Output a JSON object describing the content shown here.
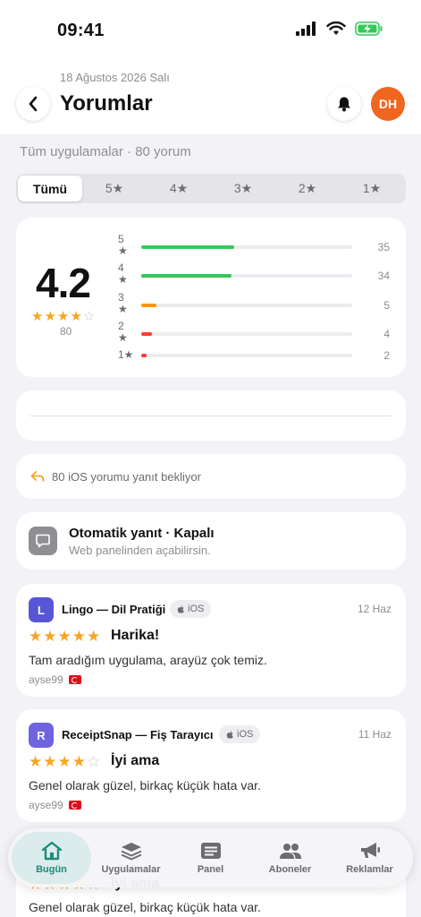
{
  "status_bar": {
    "time": "09:41"
  },
  "header": {
    "date": "18 Ağustos 2026 Salı",
    "title": "Yorumlar",
    "avatar_initials": "DH"
  },
  "summary": "Tüm uygulamalar · 80 yorum",
  "filters": [
    {
      "label": "Tümü",
      "active": true
    },
    {
      "label": "5★"
    },
    {
      "label": "4★"
    },
    {
      "label": "3★"
    },
    {
      "label": "2★"
    },
    {
      "label": "1★"
    }
  ],
  "rating": {
    "average": "4.2",
    "count": "80",
    "stars_filled": 4,
    "distribution": [
      {
        "label": "5 ★",
        "count": "35",
        "fraction": 0.44,
        "color": "#34c759"
      },
      {
        "label": "4 ★",
        "count": "34",
        "fraction": 0.43,
        "color": "#34c759"
      },
      {
        "label": "3 ★",
        "count": "5",
        "fraction": 0.07,
        "color": "#ff9500"
      },
      {
        "label": "2 ★",
        "count": "4",
        "fraction": 0.05,
        "color": "#ff3b30"
      },
      {
        "label": "1★",
        "count": "2",
        "fraction": 0.025,
        "color": "#ff3b30"
      }
    ]
  },
  "pending": {
    "text": "80 iOS yorumu yanıt bekliyor"
  },
  "auto_reply": {
    "title": "Otomatik yanıt · Kapalı",
    "subtitle": "Web panelinden açabilirsin."
  },
  "reviews": [
    {
      "app_initial": "L",
      "app_color": "#5856d6",
      "app_name": "Lingo — Dil Pratiği",
      "platform": "iOS",
      "date": "12 Haz",
      "stars": 5,
      "title": "Harika!",
      "body": "Tam aradığım uygulama, arayüz çok temiz.",
      "user": "ayse99"
    },
    {
      "app_initial": "R",
      "app_color": "#6e63e0",
      "app_name": "ReceiptSnap — Fiş Tarayıcı",
      "platform": "iOS",
      "date": "11 Haz",
      "stars": 4,
      "title": "İyi ama",
      "body": "Genel olarak güzel, birkaç küçük hata var.",
      "user": "ayse99"
    },
    {
      "stars": 4,
      "title": "İyi ama",
      "body": "Genel olarak güzel, birkaç küçük hata var."
    }
  ],
  "tabs": [
    {
      "label": "Bugün",
      "icon": "home-icon",
      "active": true
    },
    {
      "label": "Uygulamalar",
      "icon": "layers-icon"
    },
    {
      "label": "Panel",
      "icon": "panel-icon"
    },
    {
      "label": "Aboneler",
      "icon": "people-icon"
    },
    {
      "label": "Reklamlar",
      "icon": "megaphone-icon"
    }
  ]
}
